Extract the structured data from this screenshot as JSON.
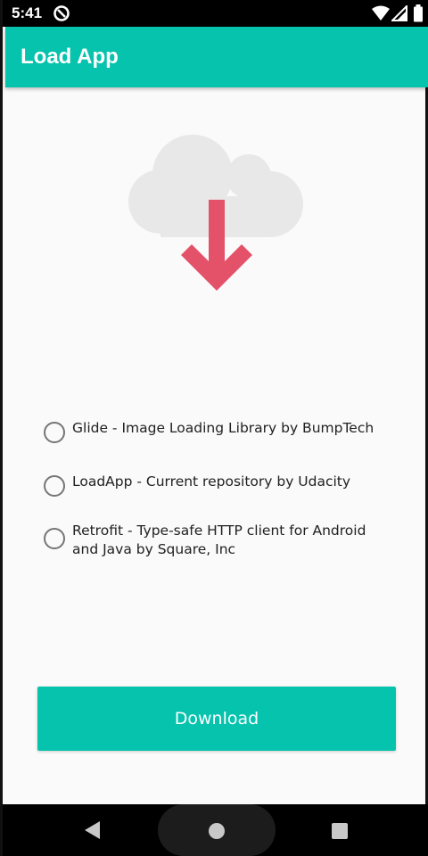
{
  "status_bar": {
    "time": "5:41",
    "icons": [
      "app-notification-icon",
      "wifi-icon",
      "cell-signal-icon",
      "battery-icon"
    ]
  },
  "app_bar": {
    "title": "Load App",
    "color": "#05c3ad"
  },
  "hero": {
    "icon": "cloud-download-icon",
    "cloud_color": "#e8e8e8",
    "arrow_color": "#e4526a"
  },
  "options": [
    {
      "label": "Glide - Image Loading Library by BumpTech",
      "selected": false
    },
    {
      "label": "LoadApp - Current repository by Udacity",
      "selected": false
    },
    {
      "label": "Retrofit - Type-safe HTTP client for Android and Java by Square, Inc",
      "selected": false
    }
  ],
  "download_button": {
    "label": "Download",
    "color": "#05c3ad"
  },
  "nav_bar": {
    "icons": [
      "back-icon",
      "home-icon",
      "recents-icon"
    ]
  }
}
